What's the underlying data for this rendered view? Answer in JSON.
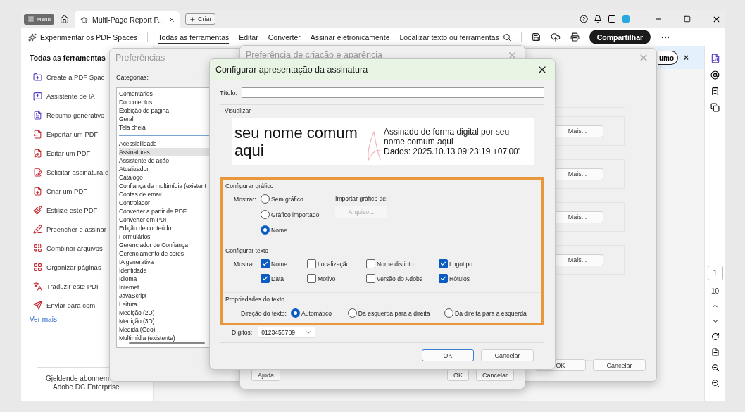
{
  "window": {
    "menu_button": "Menu",
    "tab": {
      "title": "Multi-Page Report P...",
      "selected": true
    },
    "new_button": "Criar"
  },
  "toolbar": {
    "spaces": "Experimentar os PDF Spaces",
    "items": [
      {
        "label": "Todas as ferramentas",
        "selected": true
      },
      {
        "label": "Editar",
        "selected": false
      },
      {
        "label": "Converter",
        "selected": false
      },
      {
        "label": "Assinar eletronicamente",
        "selected": false
      }
    ],
    "search": "Localizar texto ou ferramentas",
    "share": "Compartilhar"
  },
  "tools_panel": {
    "title": "Todas as ferramentas",
    "items": [
      "Create a PDF Spac",
      "Assistente de IA",
      "Resumo generativo",
      "Exportar um PDF",
      "Editar um PDF",
      "Solicitar assinatura e",
      "Criar um PDF",
      "Estilize este PDF",
      "Preencher e assinar",
      "Combinar arquivos",
      "Organizar páginas",
      "Traduzir este PDF",
      "Enviar para com."
    ],
    "more_link": "Ver mais",
    "subscription": [
      "Gjeldende abonnem",
      "Adobe DC Enterprise"
    ]
  },
  "summary_bar": {
    "button": "umo",
    "close": "×"
  },
  "page_nav": {
    "current": "1",
    "total": "10"
  },
  "preferences": {
    "title": "Preferências",
    "categories_label": "Categorias:",
    "top_categories": [
      {
        "label": "Comentários",
        "selected": false
      },
      {
        "label": "Documentos",
        "selected": false
      },
      {
        "label": "Exibição de página",
        "selected": false
      },
      {
        "label": "Geral",
        "selected": false
      },
      {
        "label": "Tela cheia",
        "selected": false
      }
    ],
    "categories": [
      {
        "label": "Acessibilidade",
        "selected": false
      },
      {
        "label": "Assinaturas",
        "selected": true
      },
      {
        "label": "Assistente de ação",
        "selected": false
      },
      {
        "label": "Atualizador",
        "selected": false
      },
      {
        "label": "Catálogo",
        "selected": false
      },
      {
        "label": "Confiança de multimídia (existent",
        "selected": false
      },
      {
        "label": "Contas de email",
        "selected": false
      },
      {
        "label": "Controlador",
        "selected": false
      },
      {
        "label": "Converter a partir de PDF",
        "selected": false
      },
      {
        "label": "Converter em PDF",
        "selected": false
      },
      {
        "label": "Edição de conteúdo",
        "selected": false
      },
      {
        "label": "Formulários",
        "selected": false
      },
      {
        "label": "Gerenciador de Confiança",
        "selected": false
      },
      {
        "label": "Gerenciamento de cores",
        "selected": false
      },
      {
        "label": "IA generativa",
        "selected": false
      },
      {
        "label": "Identidade",
        "selected": false
      },
      {
        "label": "Idioma",
        "selected": false
      },
      {
        "label": "Internet",
        "selected": false
      },
      {
        "label": "JavaScript",
        "selected": false
      },
      {
        "label": "Leitura",
        "selected": false
      },
      {
        "label": "Medição (2D)",
        "selected": false
      },
      {
        "label": "Medição (3D)",
        "selected": false
      },
      {
        "label": "Medida (Geo)",
        "selected": false
      },
      {
        "label": "Multimídia (existente)",
        "selected": false
      }
    ],
    "more_buttons": [
      "Mais...",
      "Mais...",
      "Mais...",
      "Mais..."
    ],
    "ok": "OK",
    "cancel": "Cancelar"
  },
  "appearance_dialog": {
    "title": "Preferência de criação e aparência",
    "help": "Ajuda",
    "ok": "OK",
    "cancel": "Cancelar"
  },
  "signature_dialog": {
    "title": "Configurar apresentação da assinatura",
    "title_label": "Título:",
    "preview": {
      "label": "Visualizar",
      "name": "seu nome comum aqui",
      "details": [
        "Assinado de forma digital por seu",
        "nome comum aqui",
        "Dados: 2025.10.13 09:23:19 +07'00'"
      ]
    },
    "graphic": {
      "heading": "Configurar gráfico",
      "show_label": "Mostrar:",
      "options": [
        {
          "label": "Sem gráfico",
          "selected": false
        },
        {
          "label": "Gráfico importado",
          "selected": false
        },
        {
          "label": "Nome",
          "selected": true
        }
      ],
      "import_label": "Importar gráfico de:",
      "file_button": {
        "label": "Arquivo...",
        "disabled": true
      }
    },
    "text": {
      "heading": "Configurar texto",
      "show_label": "Mostrar:",
      "options": [
        {
          "label": "Nome",
          "checked": true
        },
        {
          "label": "Localização",
          "checked": false
        },
        {
          "label": "Nome distinto",
          "checked": false
        },
        {
          "label": "Logotipo",
          "checked": true
        },
        {
          "label": "Data",
          "checked": true
        },
        {
          "label": "Motivo",
          "checked": false
        },
        {
          "label": "Versão do Adobe",
          "checked": false
        },
        {
          "label": "Rótulos",
          "checked": true
        }
      ]
    },
    "properties": {
      "heading": "Propriedades do texto",
      "direction_label": "Direção do texto:",
      "options": [
        {
          "label": "Automático",
          "selected": true
        },
        {
          "label": "Da esquerda para a direita",
          "selected": false
        },
        {
          "label": "Da direita para a esquerda",
          "selected": false
        }
      ]
    },
    "digits": {
      "label": "Dígitos:",
      "value": "0123456789"
    },
    "ok": "OK",
    "cancel": "Cancelar"
  }
}
